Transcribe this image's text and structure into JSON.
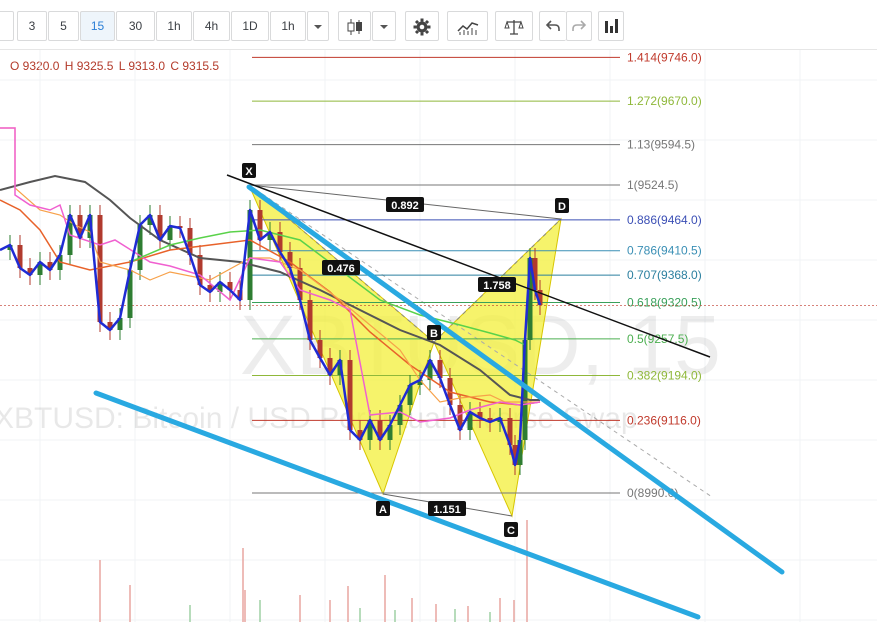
{
  "toolbar": {
    "intervals": [
      "3",
      "5",
      "15",
      "30",
      "1h",
      "4h",
      "1D",
      "1h"
    ],
    "active_interval": "15",
    "icons": [
      "candles-icon",
      "chevron-down-icon",
      "gear-icon",
      "indicators-icon",
      "scales-icon",
      "undo-icon",
      "redo-icon",
      "bar-chart-icon"
    ]
  },
  "ohlc": {
    "o": "O 9320.0",
    "h": "H 9325.5",
    "l": "L 9313.0",
    "c": "C 9315.5"
  },
  "watermark": {
    "big": "XBTUSD, 15",
    "small": "XBTUSD: Bitcoin / USD Perpetual Inverse Swap"
  },
  "chart_data": {
    "type": "candlestick",
    "symbol": "XBTUSD",
    "interval": "15",
    "fib_levels": [
      {
        "ratio": "1.414",
        "price": 9746.0,
        "label": "1.414(9746.0)",
        "color": "#c0392b"
      },
      {
        "ratio": "1.272",
        "price": 9670.0,
        "label": "1.272(9670.0)",
        "color": "#8fb83a"
      },
      {
        "ratio": "1.13",
        "price": 9594.5,
        "label": "1.13(9594.5)",
        "color": "#777777"
      },
      {
        "ratio": "1",
        "price": 9524.5,
        "label": "1(9524.5)",
        "color": "#777777"
      },
      {
        "ratio": "0.886",
        "price": 9464.0,
        "label": "0.886(9464.0)",
        "color": "#3b4fb5"
      },
      {
        "ratio": "0.786",
        "price": 9410.5,
        "label": "0.786(9410.5)",
        "color": "#3a8fb5"
      },
      {
        "ratio": "0.707",
        "price": 9368.0,
        "label": "0.707(9368.0)",
        "color": "#2a7f9f"
      },
      {
        "ratio": "0.618",
        "price": 9320.5,
        "label": "0.618(9320.5)",
        "color": "#3aa05a"
      },
      {
        "ratio": "0.5",
        "price": 9257.5,
        "label": "0.5(9257.5)",
        "color": "#4caf50"
      },
      {
        "ratio": "0.382",
        "price": 9194.0,
        "label": "0.382(9194.0)",
        "color": "#8fb83a"
      },
      {
        "ratio": "0.236",
        "price": 9116.0,
        "label": "0.236(9116.0)",
        "color": "#c0392b"
      },
      {
        "ratio": "0",
        "price": 8990.0,
        "label": "0(8990.0)",
        "color": "#777777"
      }
    ],
    "harmonic_pattern": {
      "points": [
        "X",
        "A",
        "B",
        "C",
        "D"
      ],
      "ratios": [
        "0.476",
        "0.892",
        "1.758",
        "1.151"
      ]
    },
    "ohlc_last": {
      "open": 9320.0,
      "high": 9325.5,
      "low": 9313.0,
      "close": 9315.5
    },
    "colors": {
      "price_line": "#1f2bd4",
      "candle_up": "#2e7d32",
      "candle_down": "#b03a2e",
      "trendline": "#29a9e1",
      "pattern_fill": "#f3ef3a"
    }
  }
}
